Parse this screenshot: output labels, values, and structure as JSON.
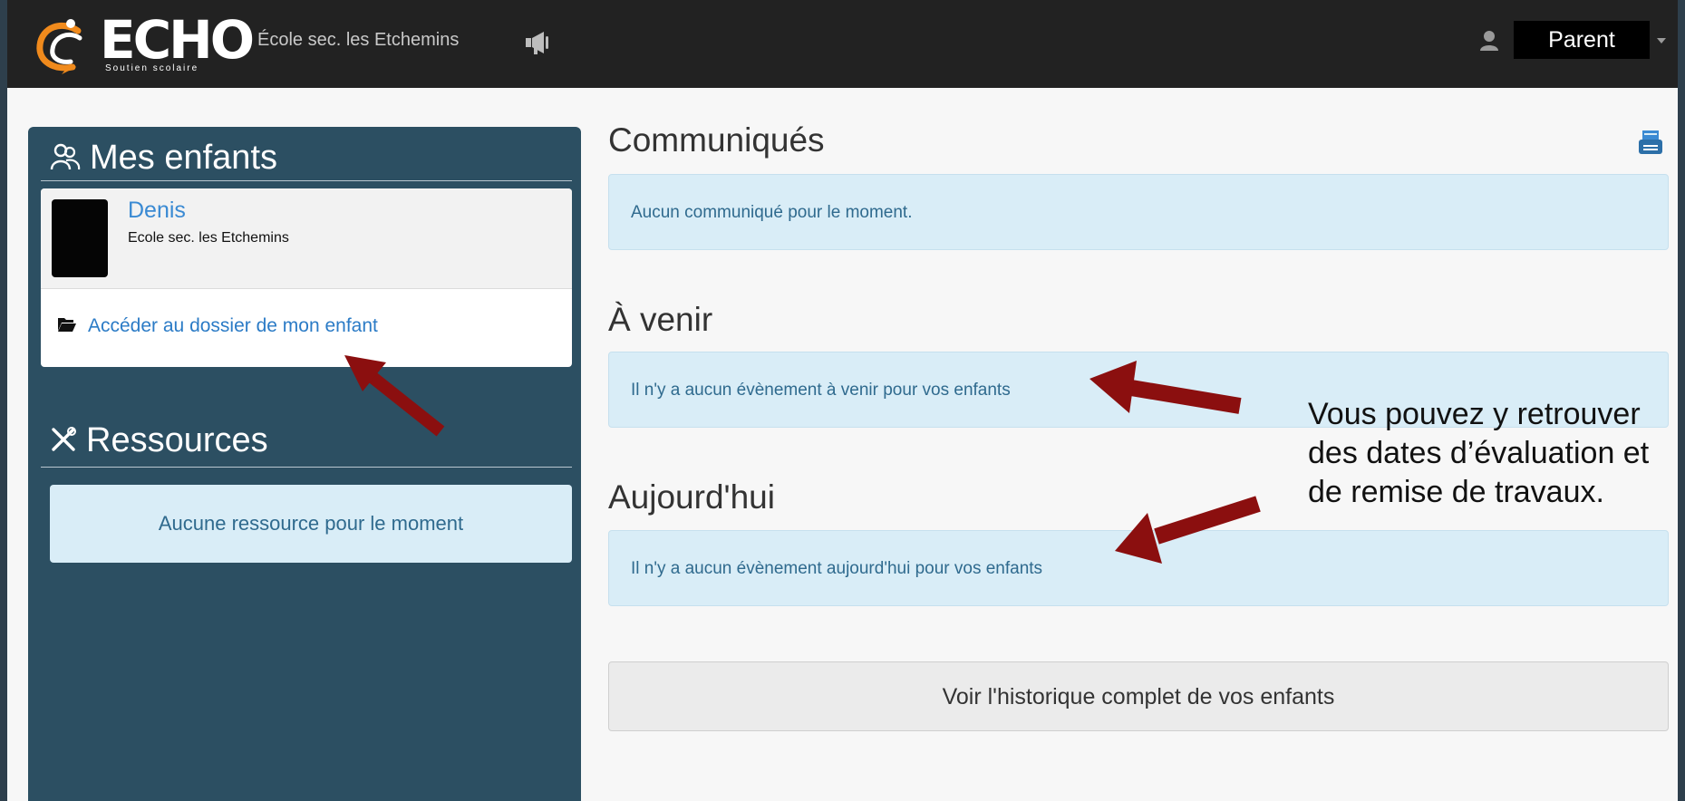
{
  "colors": {
    "navbar": "#222222",
    "sidebar": "#2c4f62",
    "info_box": "#d9edf7",
    "link": "#2b7bc6",
    "arrow": "#8b0f0f"
  },
  "header": {
    "logo_text": "ECHO",
    "logo_subtitle": "Soutien scolaire",
    "school": "École sec. les Etchemins",
    "announcement_icon": "megaphone-icon",
    "user_icon": "user-icon",
    "role": "Parent"
  },
  "sidebar": {
    "children_title": "Mes enfants",
    "children_icon": "users-icon",
    "child": {
      "name": "Denis",
      "school": "Ecole sec. les Etchemins",
      "link_label": "Accéder au dossier de mon enfant",
      "link_icon": "folder-open-icon"
    },
    "resources_title": "Ressources",
    "resources_icon": "tools-icon",
    "resources_empty": "Aucune ressource pour le moment"
  },
  "main": {
    "communiques": {
      "title": "Communiqués",
      "message": "Aucun communiqué pour le moment.",
      "icon": "print-icon"
    },
    "upcoming": {
      "title": "À venir",
      "message": "Il n'y a aucun évènement à venir pour vos enfants"
    },
    "today": {
      "title": "Aujourd'hui",
      "message": "Il n'y a aucun évènement aujourd'hui pour vos enfants"
    },
    "history_button": "Voir l'historique complet de vos enfants"
  },
  "annotation": {
    "text": "Vous pouvez y retrouver des dates d’évaluation et de remise de travaux."
  }
}
